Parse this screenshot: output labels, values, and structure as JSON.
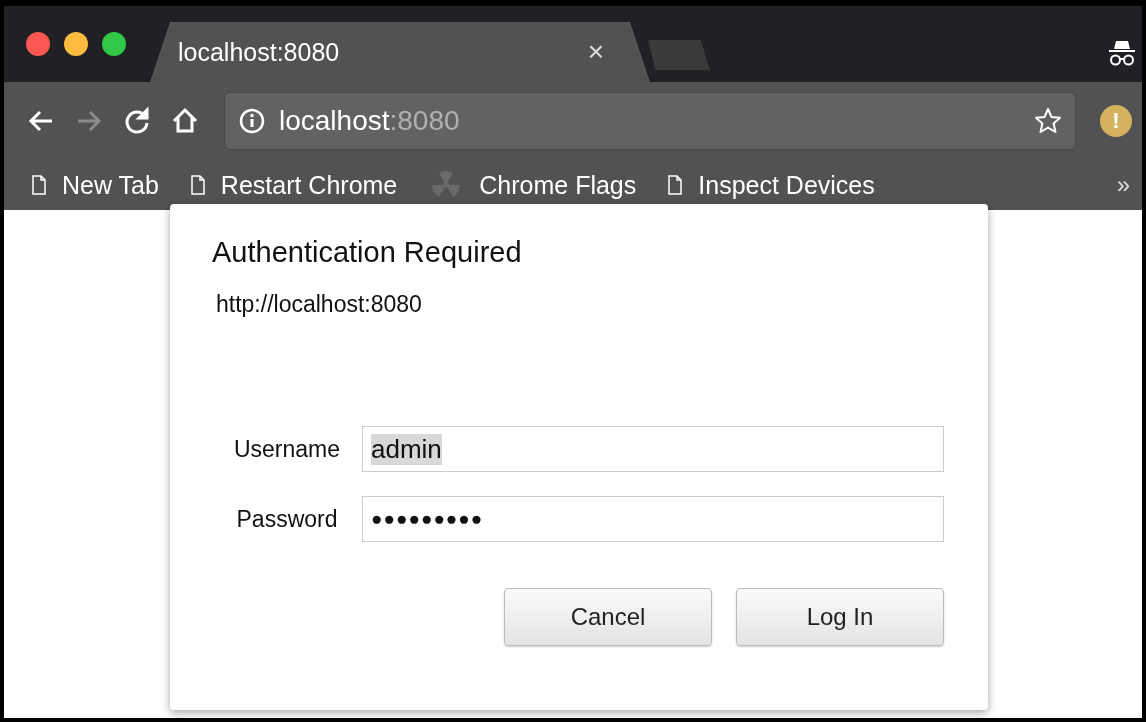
{
  "tab": {
    "title": "localhost:8080",
    "close": "×"
  },
  "toolbar": {
    "buttons": [
      {
        "kind": "back",
        "disabled": false
      },
      {
        "kind": "forward",
        "disabled": true
      },
      {
        "kind": "reload",
        "disabled": false
      },
      {
        "kind": "home",
        "disabled": false
      }
    ],
    "address": {
      "host": "localhost",
      "port": ":8080"
    },
    "alert": "!"
  },
  "bookmarks": {
    "items": [
      {
        "label": "New Tab",
        "kind": "page"
      },
      {
        "label": "Restart Chrome",
        "kind": "page"
      },
      {
        "label": "Chrome Flags",
        "kind": "flags"
      },
      {
        "label": "Inspect Devices",
        "kind": "page"
      }
    ],
    "more": "»"
  },
  "dialog": {
    "title": "Authentication Required",
    "origin": "http://localhost:8080",
    "fields": [
      {
        "label": "Username",
        "value": "admin",
        "value_selected": true
      },
      {
        "label": "Password",
        "value": "●●●●●●●●●",
        "value_selected": false
      }
    ],
    "buttons": [
      "Cancel",
      "Log In"
    ]
  }
}
